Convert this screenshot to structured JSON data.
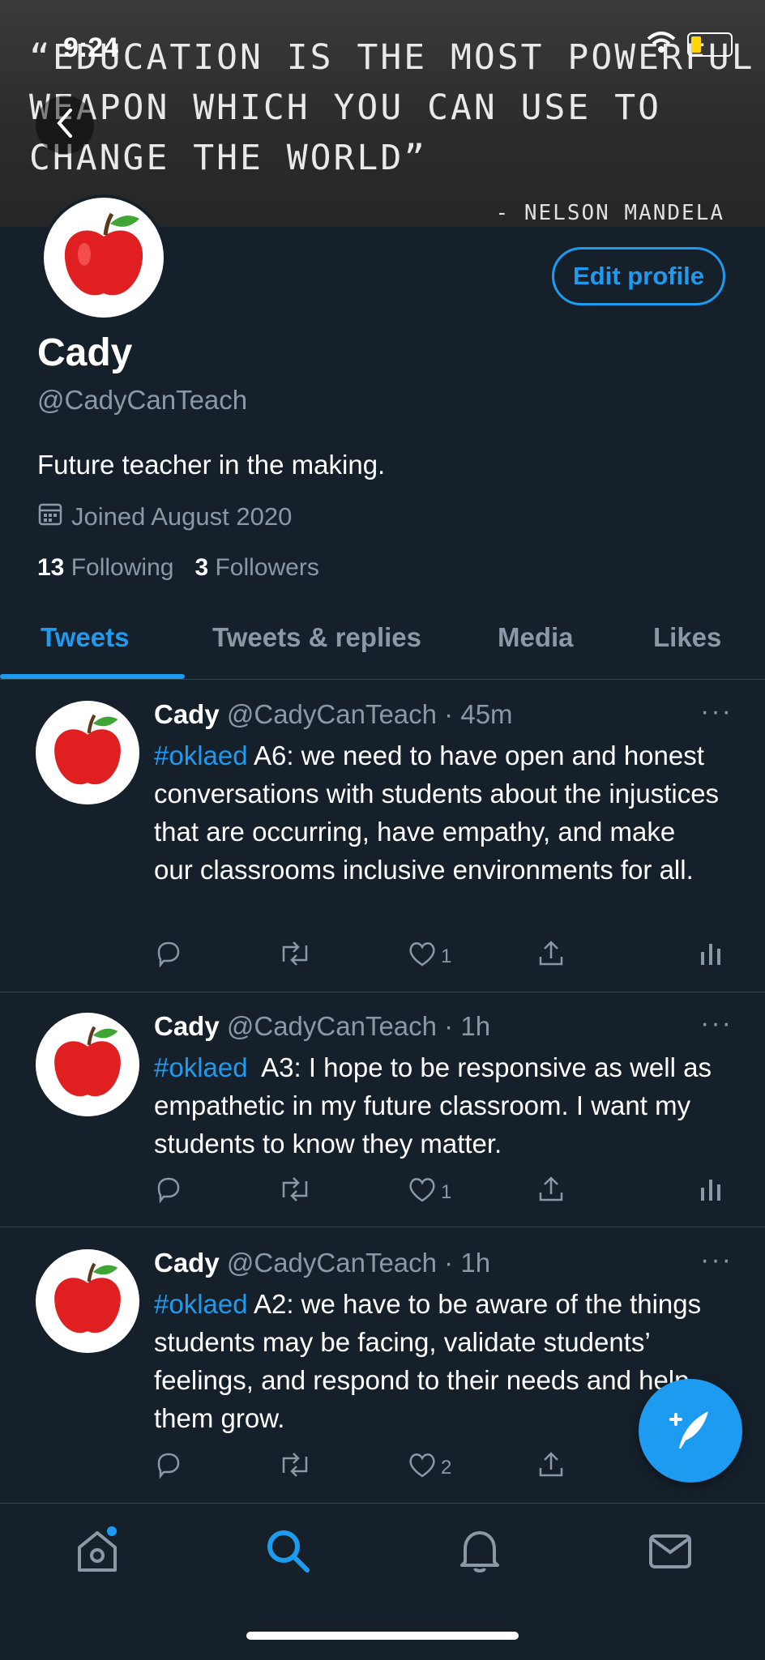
{
  "status_bar": {
    "time": "9:24"
  },
  "banner": {
    "quote_lines": [
      "“EDUCATION IS THE MOST POWERFUL",
      "WEAPON WHICH YOU CAN USE TO",
      "CHANGE THE WORLD”"
    ],
    "author": "- NELSON MANDELA"
  },
  "profile": {
    "edit_label": "Edit profile",
    "name": "Cady",
    "handle": "@CadyCanTeach",
    "bio": "Future teacher in the making.",
    "joined": "Joined August 2020",
    "following_count": "13",
    "following_label": "Following",
    "followers_count": "3",
    "followers_label": "Followers"
  },
  "tabs": [
    {
      "label": "Tweets"
    },
    {
      "label": "Tweets & replies"
    },
    {
      "label": "Media"
    },
    {
      "label": "Likes"
    }
  ],
  "tweets": [
    {
      "name": "Cady",
      "meta": "@CadyCanTeach · 45m",
      "hashtag": "#oklaed",
      "text": " A6: we need to have open and honest conversations with students about the injustices that are occurring, have empathy, and make our classrooms inclusive environments for all.",
      "likes": "1"
    },
    {
      "name": "Cady",
      "meta": "@CadyCanTeach · 1h",
      "hashtag": "#oklaed",
      "text": "  A3: I hope to be responsive as well as empathetic in my future classroom. I want my students to know they matter.",
      "likes": "1"
    },
    {
      "name": "Cady",
      "meta": "@CadyCanTeach · 1h",
      "hashtag": "#oklaed",
      "text": " A2: we have to be aware of the things students may be facing, validate students’ feelings, and respond to their needs and help them grow.",
      "likes": "2"
    }
  ],
  "more_glyph": "···",
  "colors": {
    "background": "#15202b",
    "accent": "#1d9bf0",
    "muted": "#8b98a5",
    "divider": "#38444d"
  },
  "icons": [
    "back-icon",
    "wifi-icon",
    "battery-icon",
    "apple-icon",
    "calendar-icon",
    "reply-icon",
    "retweet-icon",
    "like-icon",
    "share-icon",
    "analytics-icon",
    "compose-icon",
    "home-icon",
    "search-icon",
    "notifications-icon",
    "messages-icon"
  ]
}
